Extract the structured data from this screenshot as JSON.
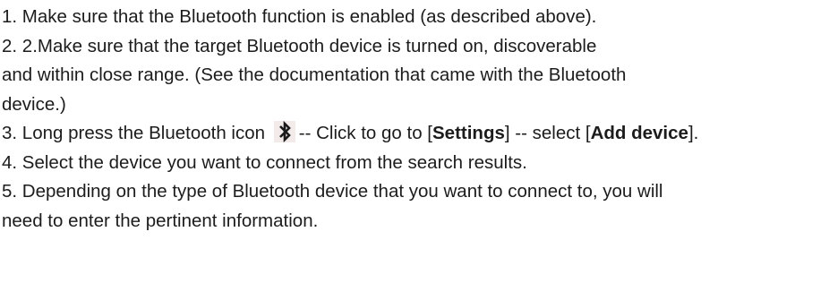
{
  "steps": {
    "s1": "1. Make sure that the Bluetooth function is enabled (as described above).",
    "s2a": "2. 2.Make sure that the target Bluetooth device is turned on, discoverable",
    "s2b": "and within close range. (See the documentation that came with the Bluetooth",
    "s2c": "device.)",
    "s3_pre": "3. Long press the Bluetooth icon",
    "s3_mid1": "-- Click to go to [",
    "s3_bold1": "Settings",
    "s3_mid2": "] -- select [",
    "s3_bold2": "Add device",
    "s3_end": "].",
    "s4": "4. Select the device you want to connect from the search results.",
    "s5a": "5. Depending on the type of Bluetooth device that you want to connect to, you will",
    "s5b": "need to enter the pertinent information."
  },
  "icons": {
    "bluetooth": "bluetooth-icon"
  }
}
